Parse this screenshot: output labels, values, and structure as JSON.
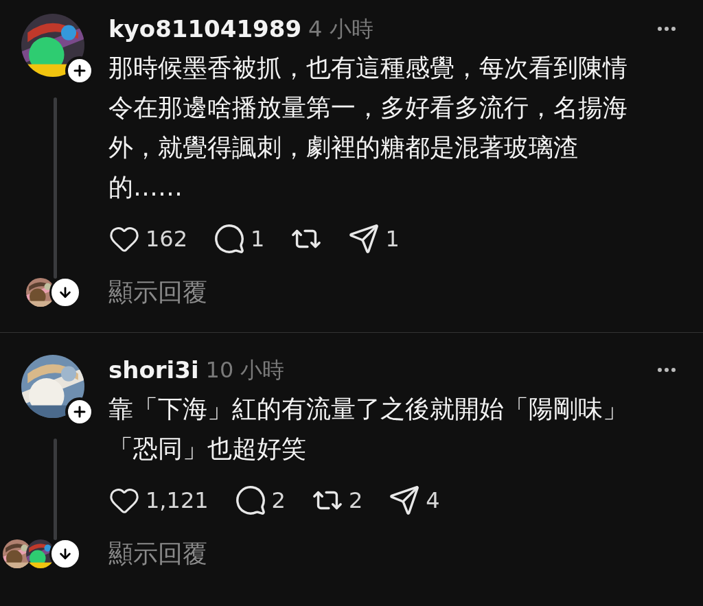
{
  "posts": [
    {
      "username": "kyo811041989",
      "time": "4 小時",
      "lines": [
        "那時候墨香被抓，也有這種感覺，每次看到陳情",
        "令在那邊啥播放量第一，多好看多流行，名揚海",
        "外，就覺得諷刺，劇裡的糖都是混著玻璃渣",
        "的……"
      ],
      "actions": [
        {
          "kind": "like",
          "count": "162"
        },
        {
          "kind": "reply",
          "count": "1"
        },
        {
          "kind": "repost"
        },
        {
          "kind": "share",
          "count": "1"
        }
      ],
      "show_replies": "顯示回覆"
    },
    {
      "username": "shori3i",
      "time": "10 小時",
      "lines": [
        "靠「下海」紅的有流量了之後就開始「陽剛味」",
        "「恐同」也超好笑"
      ],
      "actions": [
        {
          "kind": "like",
          "count": "1,121"
        },
        {
          "kind": "reply",
          "count": "2"
        },
        {
          "kind": "repost",
          "count": "2"
        },
        {
          "kind": "share",
          "count": "4"
        }
      ],
      "show_replies": "顯示回覆"
    }
  ]
}
